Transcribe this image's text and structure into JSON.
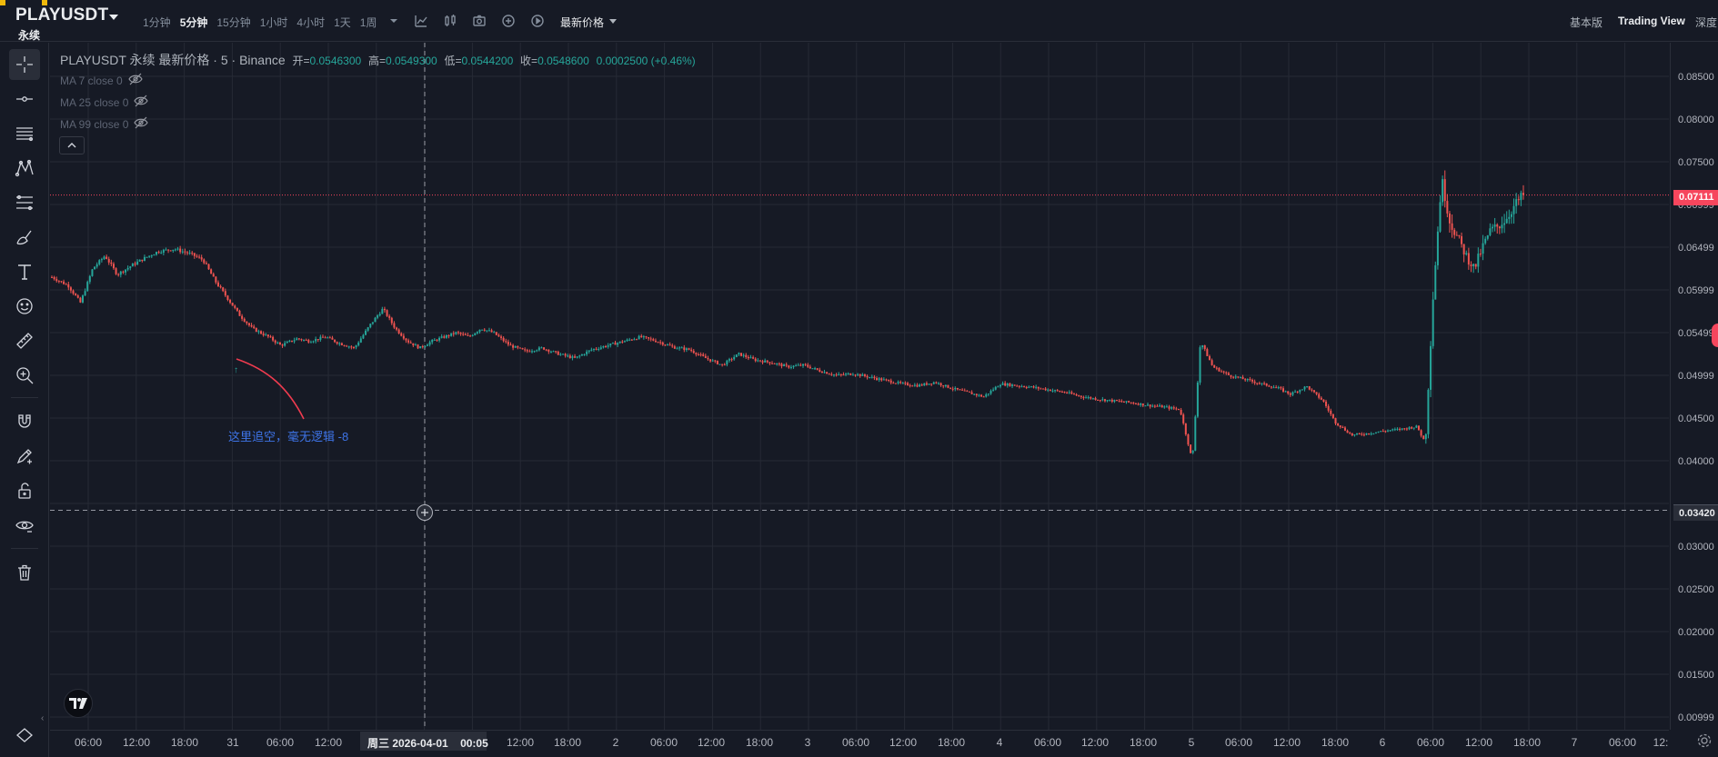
{
  "topbar": {
    "symbol": "PLAYUSDT",
    "contract_type": "永续",
    "intervals": [
      "1分钟",
      "5分钟",
      "15分钟",
      "1小时",
      "4小时",
      "1天",
      "1周"
    ],
    "active_interval": "5分钟",
    "price_type": "最新价格",
    "view_basic": "基本版",
    "view_tradingview": "Trading View",
    "view_depth": "深度"
  },
  "legend": {
    "symbol": "PLAYUSDT 永续 最新价格 · 5 · Binance",
    "open_label": "开=",
    "open": "0.0546300",
    "high_label": "高=",
    "high": "0.0549300",
    "low_label": "低=",
    "low": "0.0544200",
    "close_label": "收=",
    "close": "0.0548600",
    "change": "0.0002500 (+0.46%)",
    "ma": [
      "MA 7 close 0",
      "MA 25 close 0",
      "MA 99 close 0"
    ]
  },
  "annotation": {
    "text": "这里追空，毫无逻辑 -8",
    "color": "#3e74e8"
  },
  "price_axis": {
    "ticks": [
      "0.08500",
      "0.08000",
      "0.07500",
      "0.06999",
      "0.06499",
      "0.05999",
      "0.05499",
      "0.04999",
      "0.04500",
      "0.04000",
      "0.03000",
      "0.02500",
      "0.02000",
      "0.01500",
      "0.00999"
    ],
    "last_price": "0.07111",
    "crosshair_price": "0.03420"
  },
  "time_axis": {
    "ticks": [
      "06:00",
      "12:00",
      "18:00",
      "31",
      "06:00",
      "12:00",
      "12:00",
      "18:00",
      "2",
      "06:00",
      "12:00",
      "18:00",
      "3",
      "06:00",
      "12:00",
      "18:00",
      "4",
      "06:00",
      "12:00",
      "18:00",
      "5",
      "06:00",
      "12:00",
      "18:00",
      "6",
      "06:00",
      "12:00",
      "18:00",
      "7",
      "06:00",
      "12:"
    ],
    "crosshair_time": "周三 2026-04-01",
    "crosshair_clock": "00:05"
  },
  "colors": {
    "up": "#26a69a",
    "down": "#ef5350",
    "last_price": "#f6465d",
    "background": "#161a25",
    "grid": "#2a2e39"
  },
  "chart_data": {
    "type": "candlestick",
    "y_scale": "price (USDT)",
    "ylim": [
      0.0099,
      0.0855
    ],
    "last_price": 0.07111,
    "crosshair_price": 0.0342,
    "points": [
      [
        0,
        0.0615
      ],
      [
        0.8,
        0.0605
      ],
      [
        1.4,
        0.0585
      ],
      [
        2.0,
        0.0625
      ],
      [
        2.6,
        0.064
      ],
      [
        3.2,
        0.0618
      ],
      [
        4.0,
        0.063
      ],
      [
        4.6,
        0.0638
      ],
      [
        5.2,
        0.0645
      ],
      [
        6.0,
        0.0648
      ],
      [
        6.8,
        0.0642
      ],
      [
        7.4,
        0.0635
      ],
      [
        8.0,
        0.061
      ],
      [
        8.6,
        0.059
      ],
      [
        9.2,
        0.057
      ],
      [
        9.8,
        0.0555
      ],
      [
        10.6,
        0.0545
      ],
      [
        11.2,
        0.0535
      ],
      [
        12.0,
        0.0543
      ],
      [
        12.6,
        0.054
      ],
      [
        13.4,
        0.0545
      ],
      [
        14.0,
        0.0538
      ],
      [
        14.8,
        0.0532
      ],
      [
        15.6,
        0.056
      ],
      [
        16.2,
        0.0578
      ],
      [
        16.8,
        0.0555
      ],
      [
        17.4,
        0.054
      ],
      [
        18.0,
        0.0532
      ],
      [
        18.6,
        0.054
      ],
      [
        19.2,
        0.0545
      ],
      [
        19.8,
        0.055
      ],
      [
        20.4,
        0.0545
      ],
      [
        21.0,
        0.0555
      ],
      [
        21.6,
        0.055
      ],
      [
        22.4,
        0.0535
      ],
      [
        23.2,
        0.0528
      ],
      [
        24.0,
        0.0532
      ],
      [
        24.8,
        0.0525
      ],
      [
        25.6,
        0.052
      ],
      [
        26.4,
        0.053
      ],
      [
        27.2,
        0.0535
      ],
      [
        28.0,
        0.054
      ],
      [
        28.8,
        0.0545
      ],
      [
        29.6,
        0.054
      ],
      [
        30.4,
        0.0533
      ],
      [
        31.2,
        0.053
      ],
      [
        32.0,
        0.052
      ],
      [
        32.8,
        0.0512
      ],
      [
        33.6,
        0.0525
      ],
      [
        34.4,
        0.0518
      ],
      [
        35.2,
        0.0515
      ],
      [
        36.0,
        0.051
      ],
      [
        36.8,
        0.0512
      ],
      [
        37.6,
        0.0505
      ],
      [
        38.4,
        0.05
      ],
      [
        39.2,
        0.0502
      ],
      [
        40.0,
        0.0498
      ],
      [
        40.8,
        0.0494
      ],
      [
        41.6,
        0.049
      ],
      [
        42.4,
        0.0488
      ],
      [
        43.2,
        0.0492
      ],
      [
        44.0,
        0.0485
      ],
      [
        44.8,
        0.048
      ],
      [
        45.6,
        0.0475
      ],
      [
        46.4,
        0.049
      ],
      [
        47.2,
        0.0488
      ],
      [
        48.0,
        0.0486
      ],
      [
        48.8,
        0.0483
      ],
      [
        49.6,
        0.048
      ],
      [
        50.4,
        0.0475
      ],
      [
        51.2,
        0.0472
      ],
      [
        52.0,
        0.047
      ],
      [
        52.8,
        0.0468
      ],
      [
        53.6,
        0.0465
      ],
      [
        54.4,
        0.0463
      ],
      [
        55.2,
        0.046
      ],
      [
        55.8,
        0.04
      ],
      [
        56.2,
        0.054
      ],
      [
        56.8,
        0.051
      ],
      [
        57.6,
        0.05
      ],
      [
        58.4,
        0.0495
      ],
      [
        59.2,
        0.049
      ],
      [
        60.0,
        0.0485
      ],
      [
        60.6,
        0.0478
      ],
      [
        61.4,
        0.0487
      ],
      [
        62.2,
        0.047
      ],
      [
        62.8,
        0.0445
      ],
      [
        63.6,
        0.043
      ],
      [
        64.4,
        0.0432
      ],
      [
        65.2,
        0.0435
      ],
      [
        66.0,
        0.0437
      ],
      [
        66.8,
        0.044
      ],
      [
        67.2,
        0.042
      ],
      [
        67.6,
        0.06
      ],
      [
        68.0,
        0.073
      ],
      [
        68.4,
        0.068
      ],
      [
        68.8,
        0.066
      ],
      [
        69.2,
        0.064
      ],
      [
        69.6,
        0.0625
      ],
      [
        70.0,
        0.065
      ],
      [
        70.4,
        0.067
      ],
      [
        70.8,
        0.0675
      ],
      [
        71.2,
        0.0685
      ],
      [
        71.6,
        0.07
      ],
      [
        72.0,
        0.0711
      ]
    ]
  }
}
